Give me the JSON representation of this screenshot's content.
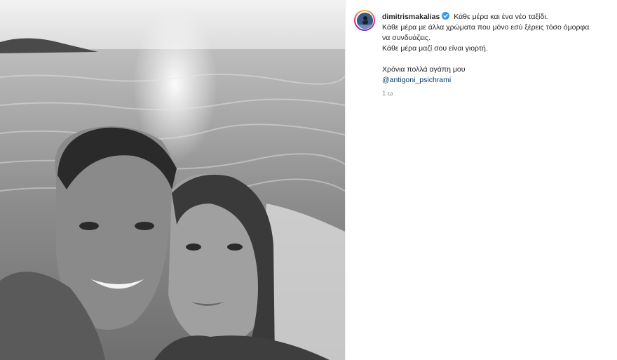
{
  "post": {
    "username": "dimitrismakalias",
    "caption_first": "Κάθε μέρα και ένα νέο ταξίδι.",
    "caption_lines": [
      "Κάθε μέρα με άλλα χρώματα που μόνο εσύ ξέρεις τόσο όμορφα",
      "να συνδυάζεις.",
      "Κάθε μέρα μαζί σου είναι γιορτή."
    ],
    "wish_line": "Χρόνια πολλά αγάπη μου",
    "mention": "@antigoni_psichrami",
    "time_ago": "1 ω"
  },
  "colors": {
    "verified_badge": "#3897f0",
    "mention_link": "#00376b",
    "timestamp": "#8e8e8e",
    "text": "#262626"
  },
  "icons": {
    "verified": "verified-badge-icon"
  }
}
